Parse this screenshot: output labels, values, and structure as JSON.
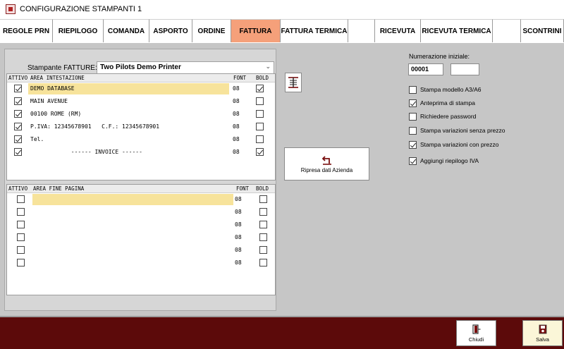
{
  "window": {
    "title": "CONFIGURAZIONE STAMPANTI 1"
  },
  "tabs": [
    {
      "label": "REGOLE PRN",
      "width": 75
    },
    {
      "label": "RIEPILOGO",
      "width": 72
    },
    {
      "label": "COMANDA",
      "width": 65
    },
    {
      "label": "ASPORTO",
      "width": 61
    },
    {
      "label": "ORDINE",
      "width": 55
    },
    {
      "label": "FATTURA",
      "width": 70,
      "active": true
    },
    {
      "label": "FATTURA TERMICA",
      "width": 96
    },
    {
      "label": "",
      "width": 38
    },
    {
      "label": "RICEVUTA",
      "width": 65
    },
    {
      "label": "RICEVUTA TERMICA",
      "width": 102
    },
    {
      "label": "",
      "width": 40
    },
    {
      "label": "SCONTRINI",
      "width": 61
    }
  ],
  "printer": {
    "label": "Stampante FATTURE:",
    "value": "Two Pilots Demo Printer"
  },
  "header_grid": {
    "columns": {
      "attivo": "ATTIVO",
      "area": "AREA INTESTAZIONE",
      "font": "FONT",
      "bold": "BOLD"
    },
    "rows": [
      {
        "attivo": true,
        "text": "DEMO DATABASE",
        "font": "08",
        "bold": true
      },
      {
        "attivo": true,
        "text": "MAIN AVENUE",
        "font": "08",
        "bold": false
      },
      {
        "attivo": true,
        "text": "00100 ROME (RM)",
        "font": "08",
        "bold": false
      },
      {
        "attivo": true,
        "text": "P.IVA: 12345678901   C.F.: 12345678901",
        "font": "08",
        "bold": false
      },
      {
        "attivo": true,
        "text": "Tel.",
        "font": "08",
        "bold": false
      },
      {
        "attivo": true,
        "text": "            ------ INVOICE ------",
        "font": "08",
        "bold": true
      }
    ]
  },
  "footer_grid": {
    "columns": {
      "attivo": "ATTIVO",
      "area": "AREA FINE PAGINA",
      "font": "FONT",
      "bold": "BOLD"
    },
    "rows": [
      {
        "attivo": false,
        "text": "",
        "font": "08",
        "bold": false
      },
      {
        "attivo": false,
        "text": "",
        "font": "08",
        "bold": false
      },
      {
        "attivo": false,
        "text": "",
        "font": "08",
        "bold": false
      },
      {
        "attivo": false,
        "text": "",
        "font": "08",
        "bold": false
      },
      {
        "attivo": false,
        "text": "",
        "font": "08",
        "bold": false
      },
      {
        "attivo": false,
        "text": "",
        "font": "08",
        "bold": false
      }
    ]
  },
  "ripresa_button": {
    "label": "Ripresa dati Azienda",
    "icon": "return-arrow-icon"
  },
  "format_button": {
    "icon": "paragraph-format-icon"
  },
  "numbering": {
    "label": "Numerazione iniziale:",
    "value": "00001",
    "suffix": ""
  },
  "options": [
    {
      "label": "Stampa modello A3/A6",
      "checked": false
    },
    {
      "label": "Anteprima di stampa",
      "checked": true
    },
    {
      "label": "Richiedere password",
      "checked": false
    },
    {
      "label": "Stampa variazioni senza prezzo",
      "checked": false
    },
    {
      "label": "Stampa variazioni con prezzo",
      "checked": true
    },
    {
      "label": "Aggiungi riepilogo IVA",
      "checked": true
    }
  ],
  "footer": {
    "close": {
      "label": "Chiudi",
      "icon": "exit-door-icon"
    },
    "save": {
      "label": "Salva",
      "icon": "save-icon"
    }
  },
  "colors": {
    "active_tab": "#f5a07a",
    "footer_bg": "#5c0a0a",
    "highlight": "#f7e39b"
  }
}
